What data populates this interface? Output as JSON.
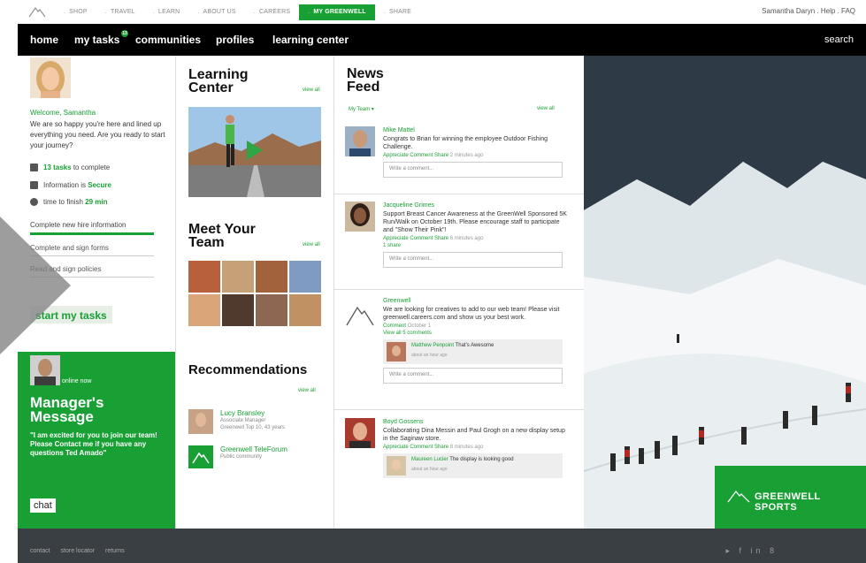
{
  "util_nav": {
    "items": [
      "SHOP",
      "TRAVEL",
      "LEARN",
      "ABOUT US",
      "CAREERS",
      "MY GREENWELL",
      "SHARE"
    ],
    "active_index": 5,
    "right_text": "Samantha Daryn . Help . FAQ"
  },
  "main_nav": {
    "items": [
      "home",
      "my tasks",
      "communities",
      "profiles",
      "learning center"
    ],
    "tasks_badge": "13",
    "search": "search"
  },
  "left_col": {
    "welcome": "Welcome, Samantha",
    "welcome_body": "We are so happy you're here and lined up everything you need. Are you ready to start your journey?",
    "stat1_prefix": "",
    "stat1_value": "13 tasks",
    "stat1_suffix": "to complete",
    "stat2_prefix": "Information is",
    "stat2_value": "Secure",
    "stat3_prefix": "time to finish",
    "stat3_value": "29 min",
    "tasks": [
      "Complete new hire information",
      "Complete and sign forms",
      "Read and sign policies"
    ],
    "start_btn": "start my tasks"
  },
  "manager": {
    "online": "online now",
    "title": "Manager's Message",
    "quote": "\"I am excited for you to join our team! Please Contact me if you have any questions Ted Amado\"",
    "chat": "chat"
  },
  "learning": {
    "title": "Learning Center",
    "view_all": "view all"
  },
  "team": {
    "title": "Meet Your Team",
    "view_all": "view all",
    "faces": [
      "#b85f3b",
      "#c6a178",
      "#a1623c",
      "#7f9bc2",
      "#d9a579",
      "#4f3a2d",
      "#8d6751",
      "#bf9163"
    ]
  },
  "recommendations": {
    "title": "Recommendations",
    "view_all": "view all",
    "items": [
      {
        "name": "Lucy Bransley",
        "sub1": "Associate Manager",
        "sub2": "Greenwell Top 10, 43 years"
      },
      {
        "name": "Greenwell TeleForum",
        "sub1": "Public community",
        "sub2": ""
      }
    ]
  },
  "news": {
    "title": "News Feed",
    "filter": "My Team ▾",
    "view_all": "view all",
    "posts": [
      {
        "author": "Mike Mattel",
        "text": "Congrats to Brian for winning the employee Outdoor Fishing Challenge.",
        "acts": "Appreciate   Comment   Share",
        "time": "2 minutes ago",
        "comment_ph": "Write a comment..."
      },
      {
        "author": "Jacqueline Grimes",
        "text": "Support Breast Cancer Awareness at the GreenWell Sponsored 5K Run/Walk on October 19th. Please encourage staff to participate and \"Show Their Pink\"!",
        "acts": "Appreciate   Comment   Share",
        "time": "6 minutes ago",
        "likes": "1 share",
        "comment_ph": "Write a comment..."
      },
      {
        "author": "Greenwell",
        "text": "We are looking for creatives to add to our web team! Please visit greenwell.careers.com and show us your best work.",
        "acts": "Comment",
        "time": "October 1",
        "comments_link": "View all 5 comments",
        "reply_name": "Matthew Penpoint",
        "reply_text": "That's Awesome",
        "reply_time": "about an hour ago",
        "comment_ph": "Write a comment..."
      },
      {
        "author": "Boyd Gossens",
        "text": "Collaborating Dina Messin and Paul Grogh on a new display setup in the Saginaw store.",
        "acts": "Appreciate   Comment   Share",
        "time": "8 minutes ago",
        "reply_name": "Maureen Lucier",
        "reply_text": "The display is looking good",
        "reply_time": "about an hour ago"
      }
    ]
  },
  "brand": {
    "badge": "GREENWELL SPORTS"
  },
  "footer": {
    "links": [
      "contact",
      "store locator",
      "returns"
    ],
    "social": "▸ f in 8"
  },
  "colors": {
    "green": "#19a035",
    "nav_black": "#000000",
    "footer_gray": "#3a3f44"
  }
}
